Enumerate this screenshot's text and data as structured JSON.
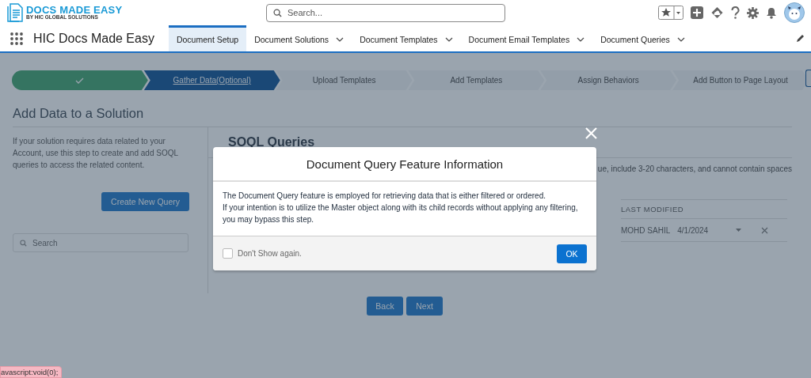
{
  "header": {
    "logo": {
      "title": "DOCS MADE EASY",
      "subtitle": "BY HIC GLOBAL SOLUTIONS"
    },
    "search": {
      "placeholder": "Search..."
    }
  },
  "nav": {
    "app_name": "HIC Docs Made Easy",
    "tabs": [
      {
        "label": "Document Setup",
        "selected": true,
        "has_menu": false
      },
      {
        "label": "Document Solutions",
        "selected": false,
        "has_menu": true
      },
      {
        "label": "Document Templates",
        "selected": false,
        "has_menu": true
      },
      {
        "label": "Document Email Templates",
        "selected": false,
        "has_menu": true
      },
      {
        "label": "Document Queries",
        "selected": false,
        "has_menu": true
      }
    ]
  },
  "path": {
    "steps": [
      {
        "complete": true,
        "selected": false
      },
      {
        "label": "Gather Data(Optional)",
        "complete": false,
        "selected": true
      },
      {
        "label": "Upload Templates",
        "complete": false,
        "selected": false
      },
      {
        "label": "Add Templates",
        "complete": false,
        "selected": false
      },
      {
        "label": "Assign Behaviors",
        "complete": false,
        "selected": false
      },
      {
        "label": "Add Button to Page Layout",
        "complete": false,
        "selected": false
      }
    ]
  },
  "page": {
    "title": "Add Data to a Solution",
    "description": "If your solution requires data related to your Account, use this step to create and add SOQL queries to access the related content.",
    "create_button": "Create New Query",
    "search": {
      "placeholder": "Search"
    },
    "section_title": "SOQL Queries",
    "hint": "ue, include 3-20 characters, and cannot contain spaces",
    "table": {
      "columns": [
        "LAST MODIFIED"
      ],
      "rows": [
        {
          "modified_by": "MOHD SAHIL",
          "date": "4/1/2024"
        }
      ]
    },
    "buttons": [
      "Back",
      "Next"
    ]
  },
  "modal": {
    "title": "Document Query Feature Information",
    "lines": [
      "The Document Query feature is employed for retrieving data that is either filtered or ordered.",
      "If your intention is to utilize the Master object along with its child records without applying any filtering,",
      "you may bypass this step."
    ],
    "checkbox": {
      "label": "Don't Show again.",
      "checked": false
    },
    "ok_button": "OK"
  },
  "status_link": "avascript:void(0);"
}
